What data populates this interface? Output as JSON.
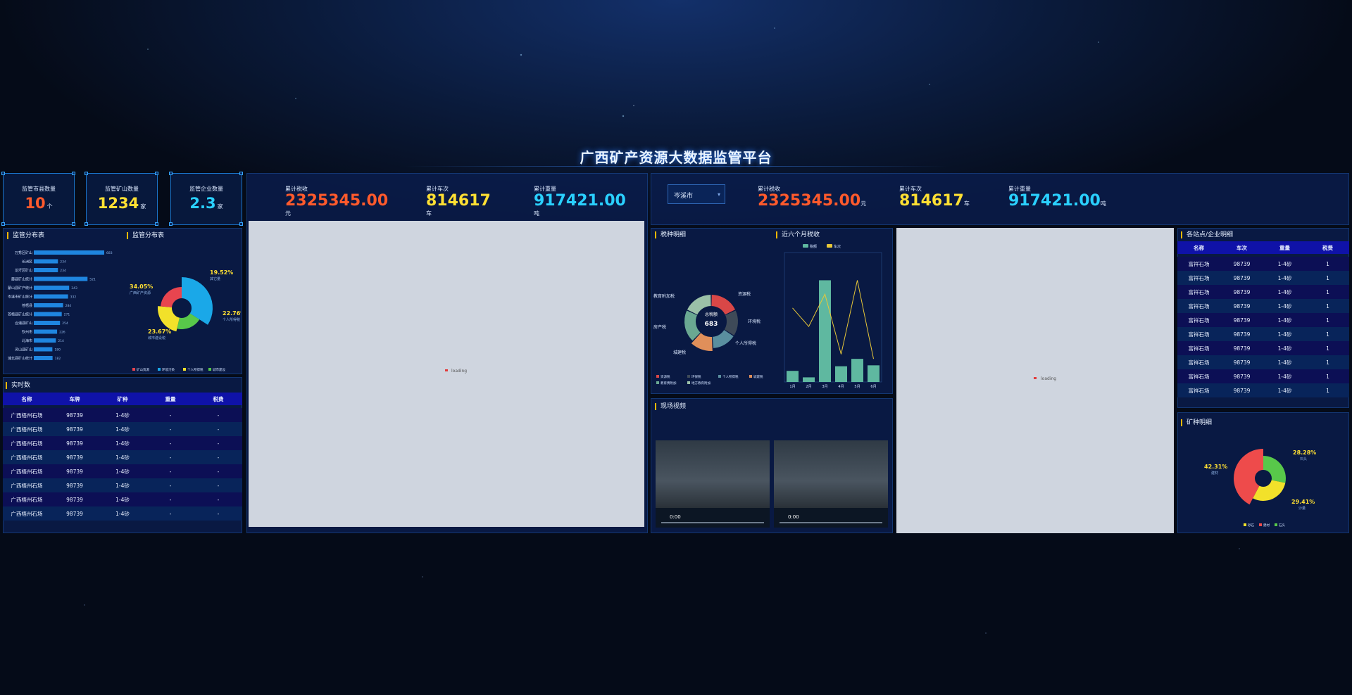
{
  "title": "广西矿产资源大数据监管平台",
  "stats": [
    {
      "label": "监管市县数量",
      "value": "10",
      "unit": "个",
      "color": "#ff5a2c"
    },
    {
      "label": "监管矿山数量",
      "value": "1234",
      "unit": "家",
      "color": "#ffe033"
    },
    {
      "label": "监管企业数量",
      "value": "2.3",
      "unit": "家",
      "color": "#2ad0ff"
    }
  ],
  "totals_left": [
    {
      "label": "累计税收",
      "value": "2325345.00",
      "unit": "元",
      "color": "#ff5a2c"
    },
    {
      "label": "累计车次",
      "value": "814617",
      "unit": "车",
      "color": "#ffe033"
    },
    {
      "label": "累计重量",
      "value": "917421.00",
      "unit": "吨",
      "color": "#2ad0ff"
    }
  ],
  "totals_right": [
    {
      "label": "累计税收",
      "value": "2325345.00",
      "unit": "元",
      "color": "#ff5a2c"
    },
    {
      "label": "累计车次",
      "value": "814617",
      "unit": "车",
      "color": "#ffe033"
    },
    {
      "label": "累计重量",
      "value": "917421.00",
      "unit": "吨",
      "color": "#2ad0ff"
    }
  ],
  "city_select": "岑溪市",
  "panels": {
    "dist_bar": "监管分布表",
    "dist_pie": "监管分布表",
    "realtime": "实时数",
    "tax_detail": "税种明细",
    "six_month": "近六个月税收",
    "video": "现场视频",
    "stations": "各站点/企业明细",
    "mineral": "矿种明细"
  },
  "loading_text": "loading",
  "video": {
    "time": "0:00"
  },
  "dist_bar_chart": {
    "type": "bar",
    "categories": [
      "万秀区矿山",
      "长洲区",
      "龙圩区矿山",
      "藤县矿山统计",
      "蒙山县矿产统计",
      "岑溪市矿山统计",
      "苍梧县",
      "苍梧县矿山统计",
      "合浦县矿山",
      "钦州市",
      "北海市",
      "灵山县矿山",
      "浦北县矿山统计"
    ],
    "values": [
      683,
      234,
      234,
      521,
      343,
      332,
      284,
      271,
      254,
      226,
      214,
      180,
      182
    ]
  },
  "dist_pie_chart": {
    "type": "pie",
    "series": [
      {
        "name": "广西矿产资源",
        "pct": "34.05%",
        "value": 34.05,
        "color": "#1aa8e8"
      },
      {
        "name": "其它量",
        "pct": "19.52%",
        "value": 19.52,
        "color": "#58c84a"
      },
      {
        "name": "个人所得税",
        "pct": "22.76%",
        "value": 22.76,
        "color": "#f2e12a"
      },
      {
        "name": "城市建设税",
        "pct": "23.67%",
        "value": 23.67,
        "color": "#e8454f"
      }
    ],
    "legend": [
      "矿山资源",
      "环境污染",
      "个人所得税",
      "城市建设"
    ]
  },
  "tax_donut": {
    "type": "pie",
    "center_label": "总税额",
    "center_value": "683",
    "labels": [
      "资源税",
      "环境税",
      "个人所得税",
      "城建税",
      "教育附加税",
      "房产税"
    ],
    "colors": [
      "#d94747",
      "#3e4a58",
      "#5a8f9f",
      "#e08f5a",
      "#6aa892",
      "#9bc1a8"
    ],
    "values": [
      18,
      16,
      15,
      13,
      20,
      18
    ],
    "legend": [
      "资源税",
      "环保税",
      "个人所得税",
      "城建税",
      "教育费附加",
      "地方教育附加"
    ]
  },
  "six_month_chart": {
    "type": "bar",
    "categories": [
      "1月",
      "2月",
      "3月",
      "4月",
      "5月",
      "6月"
    ],
    "series": [
      {
        "name": "税额",
        "values": [
          12,
          5,
          110,
          17,
          25,
          18
        ],
        "color": "#5fb8a0"
      },
      {
        "name": "车次",
        "values": [
          80,
          60,
          95,
          30,
          110,
          25
        ],
        "color": "#e8c838"
      }
    ],
    "ylim": [
      0,
      140
    ]
  },
  "realtime_table": {
    "columns": [
      "名称",
      "车牌",
      "矿种",
      "重量",
      "税费"
    ],
    "rows": [
      [
        "广西梧州石场",
        "98739",
        "1-4砂",
        "-",
        "-"
      ],
      [
        "广西梧州石场",
        "98739",
        "1-4砂",
        "-",
        "-"
      ],
      [
        "广西梧州石场",
        "98739",
        "1-4砂",
        "-",
        "-"
      ],
      [
        "广西梧州石场",
        "98739",
        "1-4砂",
        "-",
        "-"
      ],
      [
        "广西梧州石场",
        "98739",
        "1-4砂",
        "-",
        "-"
      ],
      [
        "广西梧州石场",
        "98739",
        "1-4砂",
        "-",
        "-"
      ],
      [
        "广西梧州石场",
        "98739",
        "1-4砂",
        "-",
        "-"
      ],
      [
        "广西梧州石场",
        "98739",
        "1-4砂",
        "-",
        "-"
      ]
    ]
  },
  "station_table": {
    "columns": [
      "名称",
      "车次",
      "重量",
      "税费"
    ],
    "rows": [
      [
        "富祥石场",
        "98739",
        "1-4砂",
        "1"
      ],
      [
        "富祥石场",
        "98739",
        "1-4砂",
        "1"
      ],
      [
        "富祥石场",
        "98739",
        "1-4砂",
        "1"
      ],
      [
        "富祥石场",
        "98739",
        "1-4砂",
        "1"
      ],
      [
        "富祥石场",
        "98739",
        "1-4砂",
        "1"
      ],
      [
        "富祥石场",
        "98739",
        "1-4砂",
        "1"
      ],
      [
        "富祥石场",
        "98739",
        "1-4砂",
        "1"
      ],
      [
        "富祥石场",
        "98739",
        "1-4砂",
        "1"
      ],
      [
        "富祥石场",
        "98739",
        "1-4砂",
        "1"
      ],
      [
        "富祥石场",
        "98739",
        "1-4砂",
        "1"
      ]
    ]
  },
  "mineral_chart": {
    "type": "pie",
    "series": [
      {
        "name": "建材",
        "pct": "42.31%",
        "value": 42.31,
        "color": "#ee4b4b"
      },
      {
        "name": "石头",
        "pct": "28.28%",
        "value": 28.28,
        "color": "#58c84a"
      },
      {
        "name": "沙量",
        "pct": "29.41%",
        "value": 29.41,
        "color": "#f2e12a"
      }
    ],
    "legend": [
      "砂石",
      "建材",
      "石头"
    ]
  }
}
